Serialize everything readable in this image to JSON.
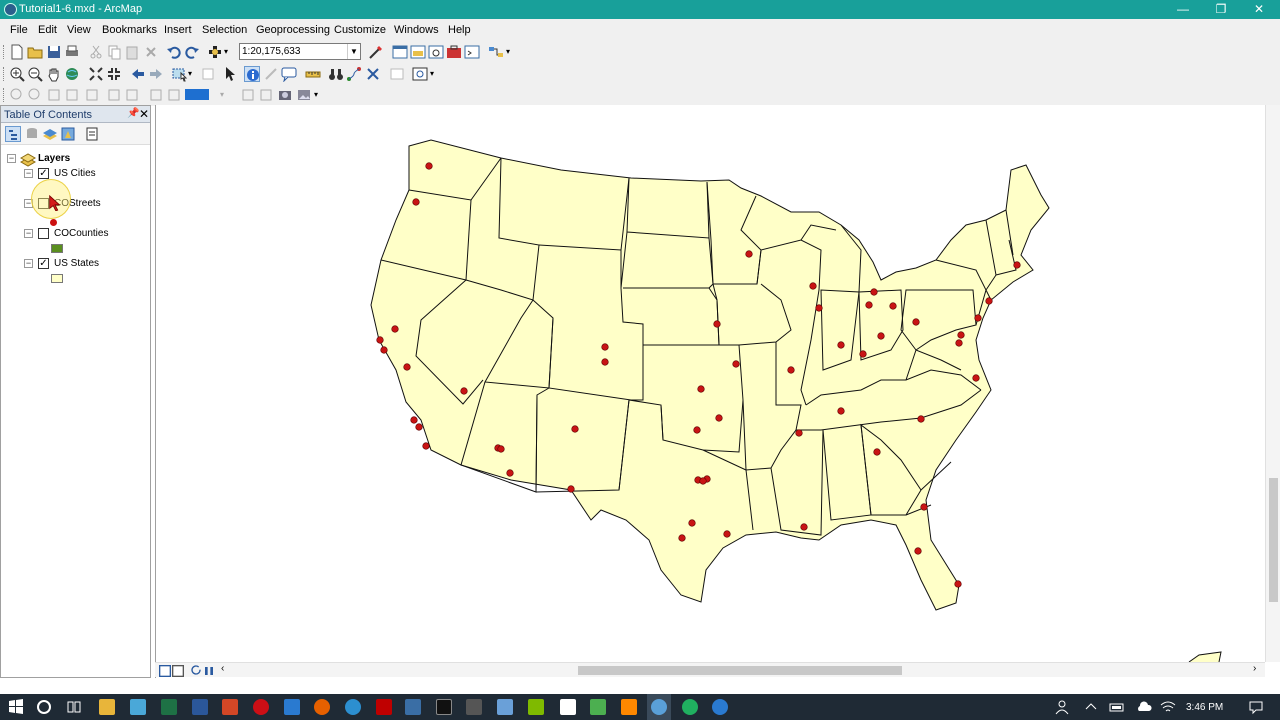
{
  "window": {
    "title": "Tutorial1-6.mxd - ArcMap",
    "min_label": "—",
    "max_label": "❐",
    "close_label": "✕"
  },
  "menu": [
    "File",
    "Edit",
    "View",
    "Bookmarks",
    "Insert",
    "Selection",
    "Geoprocessing",
    "Customize",
    "Windows",
    "Help"
  ],
  "toolbar": {
    "scale_value": "1:20,175,633"
  },
  "toc": {
    "title": "Table Of Contents",
    "pin_label": "📌",
    "close_label": "✕",
    "root_label": "Layers",
    "layers": [
      {
        "name": "US Cities",
        "checked": true,
        "symbol": "red-dot",
        "color": "#cc1111"
      },
      {
        "name": "COStreets",
        "checked": false,
        "symbol": "line",
        "color": "#c9a800"
      },
      {
        "name": "COCounties",
        "checked": false,
        "symbol": "fill",
        "color": "#5a8f1f"
      },
      {
        "name": "US States",
        "checked": true,
        "symbol": "fill",
        "color": "#ffffc8"
      }
    ]
  },
  "map": {
    "land_color": "#ffffc8",
    "city_color": "#c81414"
  },
  "status": {
    "clock": "3:46 PM"
  },
  "taskbar_icons": [
    "windows-start-icon",
    "cortana-search-icon",
    "task-view-icon",
    "file-explorer-icon",
    "app-icon",
    "excel-icon",
    "word-icon",
    "powerpoint-icon",
    "opera-icon",
    "app-icon",
    "firefox-icon",
    "chrome-icon",
    "filezilla-icon",
    "app-icon",
    "terminal-icon",
    "calculator-icon",
    "edit-icon",
    "app-icon",
    "media-player-icon",
    "notepad-icon",
    "vlc-icon",
    "arcmap-icon",
    "app-icon",
    "app-icon"
  ]
}
